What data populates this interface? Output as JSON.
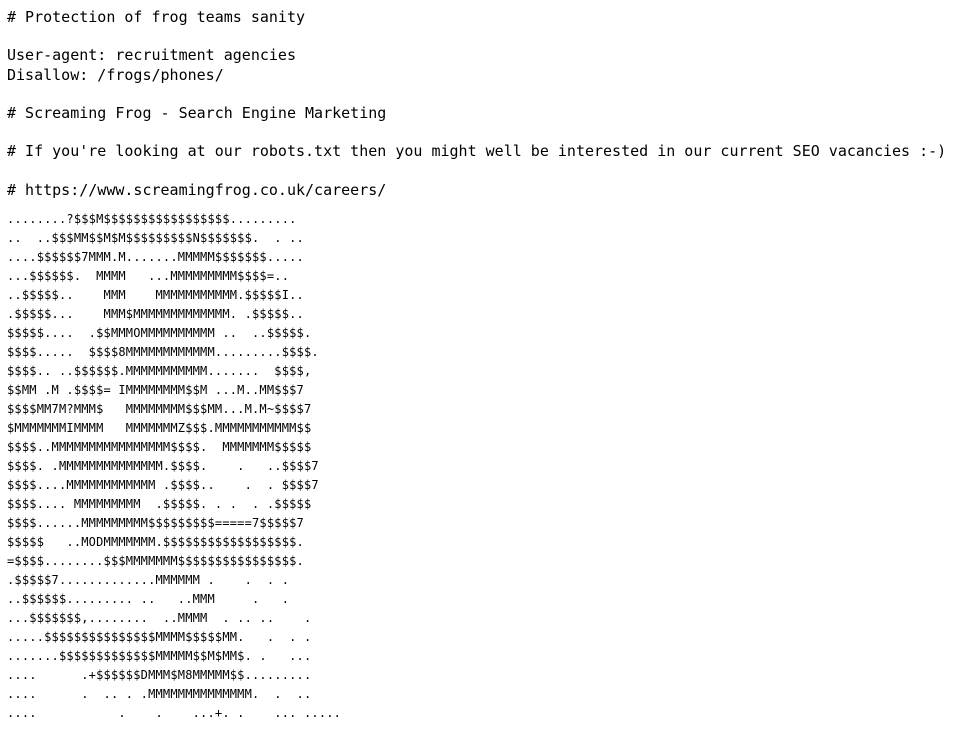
{
  "document": {
    "type": "plain-text-file",
    "file_name": "robots.txt",
    "background_color": "#ffffff",
    "text_color": "#000000"
  },
  "header": {
    "lines": [
      "# Protection of frog teams sanity",
      "",
      "User-agent: recruitment agencies",
      "Disallow: /frogs/phones/",
      "",
      "# Screaming Frog - Search Engine Marketing",
      "",
      "# If you're looking at our robots.txt then you might well be interested in our current SEO vacancies :-)",
      "",
      "# https://www.screamingfrog.co.uk/careers/"
    ],
    "text": "# Protection of frog teams sanity\n\nUser-agent: recruitment agencies\nDisallow: /frogs/phones/\n\n# Screaming Frog - Search Engine Marketing\n\n# If you're looking at our robots.txt then you might well be interested in our current SEO vacancies :-)\n\n# https://www.screamingfrog.co.uk/careers/"
  },
  "ascii_art": {
    "description": "frog-ascii-art",
    "lines": [
      "........?$$$M$$$$$$$$$$$$$$$$$.........",
      "..  ..$$$MM$$M$M$$$$$$$$$N$$$$$$$.  . ..",
      "....$$$$$$7MMM.M.......MMMMM$$$$$$$.....",
      "...$$$$$$.  MMMM   ...MMMMMMMMM$$$$=..",
      "..$$$$$..    MMM    MMMMMMMMMMM.$$$$$I..",
      ".$$$$$...    MMM$MMMMMMMMMMMMM. .$$$$$..",
      "$$$$$....  .$$MMMOMMMMMMMMMM ..  ..$$$$$.",
      "$$$$.....  $$$$8MMMMMMMMMMMM.........$$$$.",
      "$$$$.. ..$$$$$$.MMMMMMMMMMM.......  $$$$,",
      "$$MM .M .$$$$= IMMMMMMMM$$M ...M..MM$$$7",
      "$$$$MM7M?MMM$   MMMMMMMM$$$MM...M.M~$$$$7",
      "$MMMMMMMIMMMM   MMMMMMMZ$$$.MMMMMMMMMMM$$",
      "$$$$..MMMMMMMMMMMMMMMM$$$$.  MMMMMMM$$$$$",
      "$$$$. .MMMMMMMMMMMMMM.$$$$.    .   ..$$$$7",
      "$$$$....MMMMMMMMMMMM .$$$$..    .  . $$$$7",
      "$$$$.... MMMMMMMMM  .$$$$$. . .  . .$$$$$",
      "$$$$......MMMMMMMMM$$$$$$$$$=====7$$$$$7",
      "$$$$$   ..MODMMMMMMM.$$$$$$$$$$$$$$$$$$.",
      "=$$$$........$$$MMMMMMM$$$$$$$$$$$$$$$$.",
      ".$$$$$7.............MMMMMM .    .  . .",
      "..$$$$$$......... ..   ..MMM     .   .",
      "...$$$$$$$,........  ..MMMM  . .. ..    .",
      ".....$$$$$$$$$$$$$$$MMMM$$$$$MM.   .  . .",
      ".......$$$$$$$$$$$$$MMMMM$$M$MM$. .   ...",
      "....      .+$$$$$$DMMM$M8MMMMM$$.........",
      "....      .  .. . .MMMMMMMMMMMMMM.  .  ..",
      "....           .    .    ...+. .    ... ....."
    ],
    "text": "........?$$$M$$$$$$$$$$$$$$$$$.........\n..  ..$$$MM$$M$M$$$$$$$$$N$$$$$$$.  . ..\n....$$$$$$7MMM.M.......MMMMM$$$$$$$.....\n...$$$$$$.  MMMM   ...MMMMMMMMM$$$$=..\n..$$$$$..    MMM    MMMMMMMMMMM.$$$$$I..\n.$$$$$...    MMM$MMMMMMMMMMMMM. .$$$$$..\n$$$$$....  .$$MMMOMMMMMMMMMM ..  ..$$$$$.\n$$$$.....  $$$$8MMMMMMMMMMMM.........$$$$.\n$$$$.. ..$$$$$$.MMMMMMMMMMM.......  $$$$,\n$$MM .M .$$$$= IMMMMMMMM$$M ...M..MM$$$7\n$$$$MM7M?MMM$   MMMMMMMM$$$MM...M.M~$$$$7\n$MMMMMMMIMMMM   MMMMMMMZ$$$.MMMMMMMMMMM$$\n$$$$..MMMMMMMMMMMMMMMM$$$$.  MMMMMMM$$$$$\n$$$$. .MMMMMMMMMMMMMM.$$$$.    .   ..$$$$7\n$$$$....MMMMMMMMMMMM .$$$$..    .  . $$$$7\n$$$$.... MMMMMMMMM  .$$$$$. . .  . .$$$$$\n$$$$......MMMMMMMMM$$$$$$$$$=====7$$$$$7\n$$$$$   ..MODMMMMMMM.$$$$$$$$$$$$$$$$$$.\n=$$$$........$$$MMMMMMM$$$$$$$$$$$$$$$$.\n.$$$$$7.............MMMMMM .    .  . .\n..$$$$$$......... ..   ..MMM     .   .\n...$$$$$$$,........  ..MMMM  . .. ..    .\n.....$$$$$$$$$$$$$$$MMMM$$$$$MM.   .  . .\n.......$$$$$$$$$$$$$MMMMM$$M$MM$. .   ...\n....      .+$$$$$$DMMM$M8MMMMM$$.........\n....      .  .. . .MMMMMMMMMMMMMM.  .  ..\n....           .    .    ...+. .    ... ....."
  }
}
